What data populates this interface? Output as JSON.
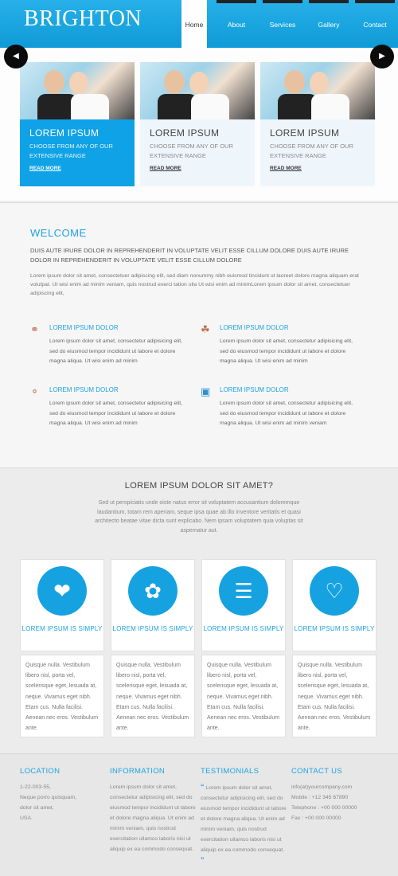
{
  "header": {
    "logo": "BRIGHTON",
    "nav": [
      {
        "label": "Home",
        "active": true
      },
      {
        "label": "About",
        "active": false
      },
      {
        "label": "Services",
        "active": false
      },
      {
        "label": "Gallery",
        "active": false
      },
      {
        "label": "Contact",
        "active": false
      }
    ]
  },
  "slider": {
    "slides": [
      {
        "title": "LOREM IPSUM",
        "text": "CHOOSE FROM ANY OF OUR EXTENSIVE RANGE",
        "link": "READ MORE"
      },
      {
        "title": "LOREM IPSUM",
        "text": "CHOOSE FROM ANY OF OUR EXTENSIVE RANGE",
        "link": "READ MORE"
      },
      {
        "title": "LOREM IPSUM",
        "text": "CHOOSE FROM ANY OF OUR EXTENSIVE RANGE",
        "link": "READ MORE"
      }
    ]
  },
  "welcome": {
    "title": "WELCOME",
    "lead": "DUIS AUTE IRURE DOLOR IN REPREHENDERIT IN VOLUPTATE VELIT ESSE CILLUM DOLORE DUIS AUTE IRURE DOLOR IN REPREHENDERIT IN VOLUPTATE VELIT ESSE CILLUM DOLORE",
    "body": "Lorem ipsum dolor sit amet, consectetuer adipiscing elit, sed diam nonummy nibh euismod tincidunt ut laoreet dolore magna aliquam erat volutpat. Ut wisi enim ad minim veniam, quis nostrud exerci tation ulla Ut wisi enim ad minimLorem ipsum dolor sit amet, consectetuer adipiscing elit,",
    "features": [
      {
        "title": "LOREM IPSUM DOLOR",
        "text": "Lorem ipsum dolor sit amet, consectetur adipisicing elit, sed do eiusmod tempor incididunt ut labore et dolore magna aliqua. Ut wisi enim ad minim",
        "icon": "rings-icon"
      },
      {
        "title": "LOREM IPSUM DOLOR",
        "text": "Lorem ipsum dolor sit amet, consectetur adipisicing elit, sed do eiusmod tempor incididunt ut labore et dolore magna aliqua. Ut wisi enim ad minim",
        "icon": "cake-icon"
      },
      {
        "title": "LOREM IPSUM DOLOR",
        "text": "Lorem ipsum dolor sit amet, consectetur adipisicing elit, sed do eiusmod tempor incididunt ut labore et dolore magna aliqua. Ut wisi enim ad minim",
        "icon": "ring-icon"
      },
      {
        "title": "LOREM IPSUM DOLOR",
        "text": "Lorem ipsum dolor sit amet, consectetur adipisicing elit, sed do eiusmod tempor incididunt ut labore et dolore magna aliqua. Ut wisi enim ad minim veniam",
        "icon": "gift-icon"
      }
    ]
  },
  "services": {
    "title": "LOREM IPSUM DOLOR SIT AMET?",
    "intro": "Sed ut perspiciatis unde oiste natus error sit voluptatem accusantium doloremque laudantium, totam rem aperiam, seque ipsa quae ab illo inventore veritatis et quasi architecto beatae vitae dicta sunt explicabo. Nem ipsam voluptatem quia voluptas sit aspernatur aut.",
    "cards": [
      {
        "icon": "heart-arrow-icon",
        "title": "LOREM IPSUM IS SIMPLY",
        "text": "Quisque nulla. Vestibulum libero nisl, porta vel, scelerisque eget, lesuada at, neque. Vivamus eget nibh. Etam cus. Nulla facilisi. Aenean nec eros. Vestibulum ante."
      },
      {
        "icon": "bouquet-icon",
        "title": "LOREM IPSUM IS SIMPLY",
        "text": "Quisque nulla. Vestibulum libero nisl, porta vel, scelerisque eget, lesuada at, neque. Vivamus eget nibh. Etam cus. Nulla facilisi. Aenean nec eros. Vestibulum ante."
      },
      {
        "icon": "wedding-cake-icon",
        "title": "LOREM IPSUM IS SIMPLY",
        "text": "Quisque nulla. Vestibulum libero nisl, porta vel, scelerisque eget, lesuada at, neque. Vivamus eget nibh. Etam cus. Nulla facilisi. Aenean nec eros. Vestibulum ante."
      },
      {
        "icon": "calendar-heart-icon",
        "title": "LOREM IPSUM IS SIMPLY",
        "text": "Quisque nulla. Vestibulum libero nisl, porta vel, scelerisque eget, lesuada at, neque. Vivamus eget nibh. Etam cus. Nulla facilisi. Aenean nec eros. Vestibulum ante."
      }
    ]
  },
  "footer": {
    "location": {
      "title": "LOCATION",
      "lines": [
        "1-22-003-55,",
        "Neque porro quisquam,",
        "dolor sit amet,",
        "USA."
      ]
    },
    "information": {
      "title": "INFORMATION",
      "text": "Lorem ipsum dolor sit amet, consectetur adipisicing elit, sed do eiusmod tempor incididunt ut labore et dolore magna aliqua. Ut enim ad minim veniam, quis nostrud exercitation ullamco laboris nisi ut aliquip ex ea commodo consequat."
    },
    "testimonials": {
      "title": "TESTIMONIALS",
      "text": "Lorem ipsum dolor sit amet, consectetur adipisicing elit, sed do eiusmod tempor incididunt ut labore et dolore magna aliqua. Ut enim ad minim veniam, quis nostrud exercitation ullamco laboris nisi ut aliquip ex ea commodo consequat."
    },
    "contact": {
      "title": "CONTACT US",
      "email": "info(at)yourcompany.com",
      "mobile": "Mobile   : +12 345 67890",
      "telephone": "Telephone : +00 000 00000",
      "fax": "Fax   : +00 000 00000"
    }
  }
}
